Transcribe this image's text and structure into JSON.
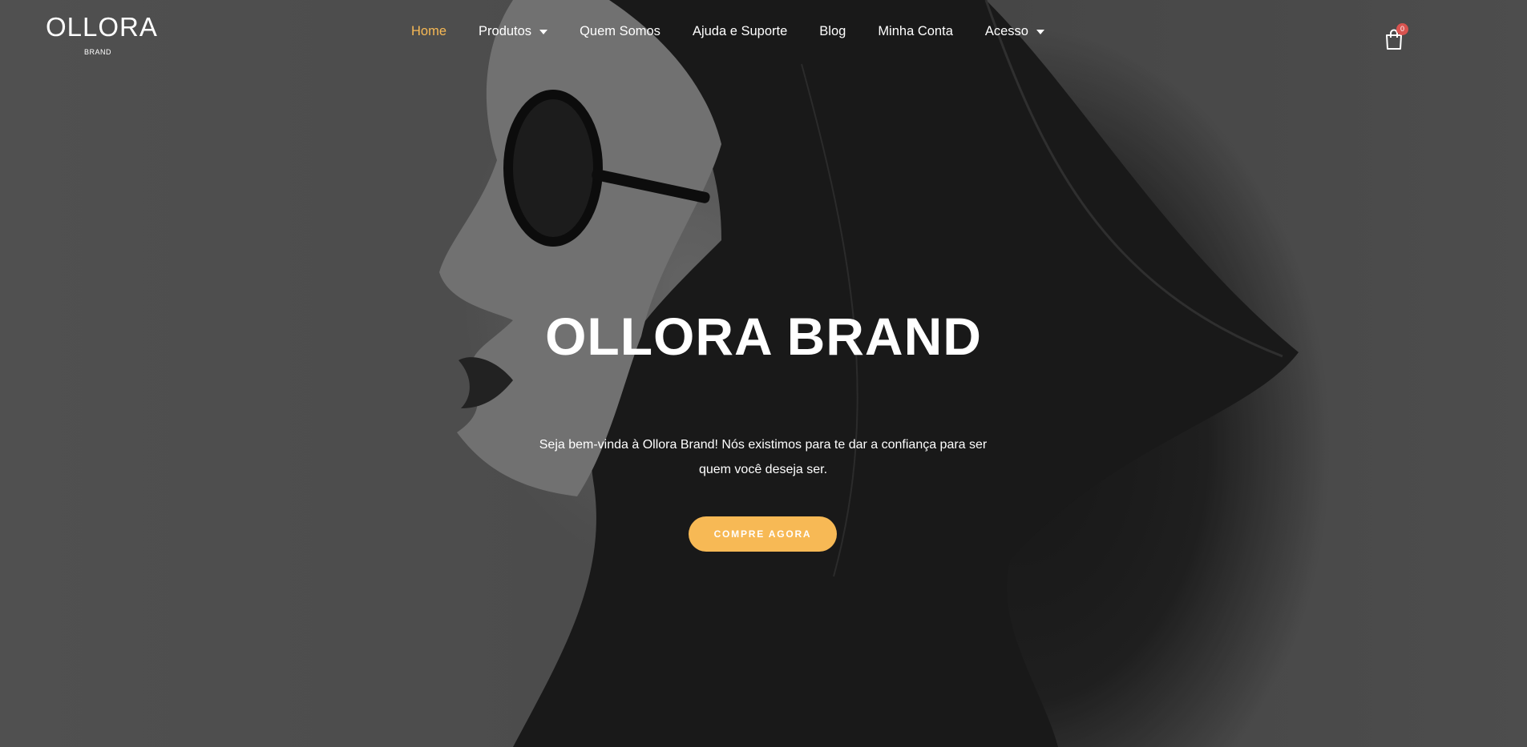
{
  "brand": {
    "name": "OLLORA",
    "sub": "BRAND"
  },
  "nav": {
    "items": [
      {
        "label": "Home",
        "active": true
      },
      {
        "label": "Produtos",
        "dropdown": true
      },
      {
        "label": "Quem Somos"
      },
      {
        "label": "Ajuda e Suporte"
      },
      {
        "label": "Blog"
      },
      {
        "label": "Minha Conta"
      },
      {
        "label": "Acesso",
        "dropdown": true
      }
    ]
  },
  "cart": {
    "count": "0",
    "icon": "shopping-bag-icon"
  },
  "hero": {
    "title": "OLLORA BRAND",
    "text": "Seja bem-vinda à Ollora Brand! Nós existimos para te dar a confiança para ser quem você deseja ser.",
    "cta": "COMPRE AGORA"
  },
  "colors": {
    "accent": "#f7b955",
    "badge": "#d9534f"
  }
}
